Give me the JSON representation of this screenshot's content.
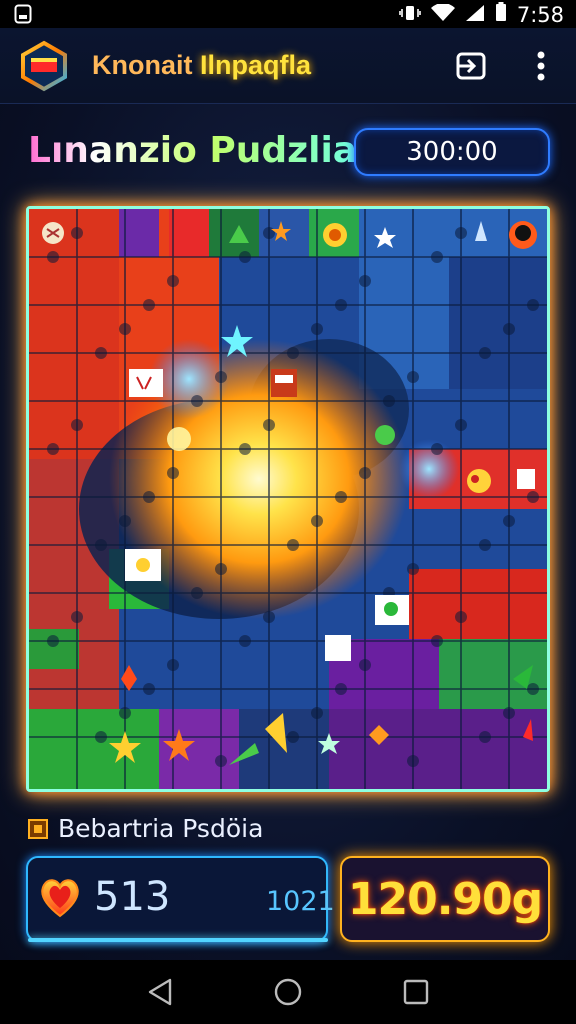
{
  "status_bar": {
    "time": "7:58"
  },
  "app": {
    "title_part1": "Knonait",
    "title_part2": "Ilnpaqfla"
  },
  "game": {
    "puzzle_title": "Lınanzio Pudzlia",
    "timer": "300:00",
    "level_label": "Bebartria  Psdöia",
    "lives": "513",
    "moves": "1021",
    "coins": "120.90g"
  },
  "colors": {
    "accent_cyan": "#2fb8ff",
    "accent_gold": "#ffb21f",
    "board_glow": "#ff8a2a"
  },
  "icons": {
    "app_logo": "hexagon-logo-icon",
    "exit": "exit-door-icon",
    "menu": "more-vertical-icon",
    "heart": "heart-icon",
    "nav_back": "back-triangle-icon",
    "nav_home": "home-circle-icon",
    "nav_recent": "recent-square-icon"
  }
}
